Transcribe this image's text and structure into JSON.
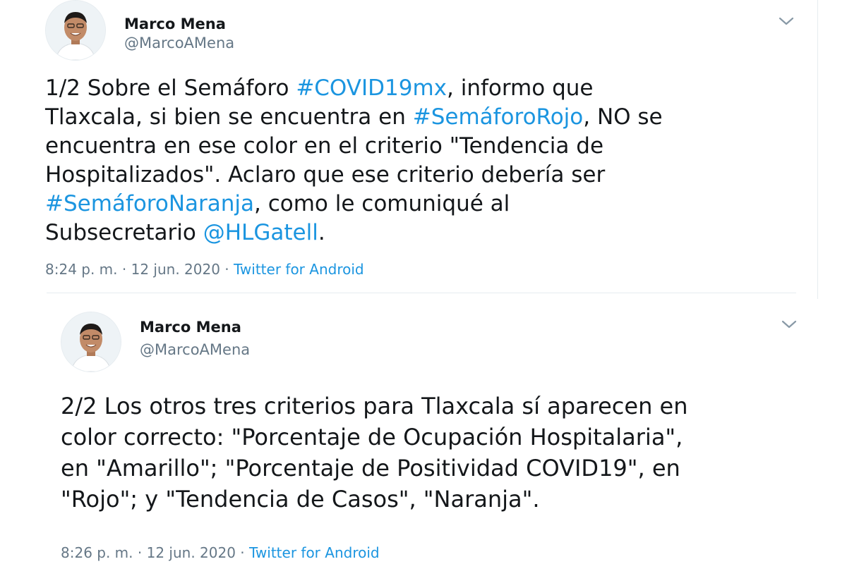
{
  "tweets": [
    {
      "author": {
        "name": "Marco Mena",
        "handle": "@MarcoAMena"
      },
      "menu_icon": "chevron-down-icon",
      "text": {
        "l1_a": "1/2 Sobre el Semáforo ",
        "l1_link": "#COVID19mx",
        "l1_b": ", informo que",
        "l2_a": "Tlaxcala, si bien se encuentra en ",
        "l2_link": "#SemáforoRojo",
        "l2_b": ", NO se",
        "l3": "encuentra en ese color en el criterio \"Tendencia de",
        "l4": "Hospitalizados\". Aclaro que ese criterio debería ser",
        "l5_link": "#SemáforoNaranja",
        "l5_b": ", como le comuniqué al",
        "l6_a": "Subsecretario ",
        "l6_link": "@HLGatell",
        "l6_b": "."
      },
      "meta": {
        "time": "8:24 p. m.",
        "sep1": " · ",
        "date": "12 jun. 2020",
        "sep2": " · ",
        "source": "Twitter for Android"
      }
    },
    {
      "author": {
        "name": "Marco Mena",
        "handle": "@MarcoAMena"
      },
      "menu_icon": "chevron-down-icon",
      "text": {
        "l1": "2/2 Los otros tres criterios para Tlaxcala sí aparecen en",
        "l2": "color correcto: \"Porcentaje de Ocupación Hospitalaria\",",
        "l3": "en \"Amarillo\"; \"Porcentaje de Positividad COVID19\", en",
        "l4": "\"Rojo\"; y \"Tendencia de Casos\", \"Naranja\"."
      },
      "meta": {
        "time": "8:26 p. m.",
        "sep1": " · ",
        "date": "12 jun. 2020",
        "sep2": " · ",
        "source": "Twitter for Android"
      }
    }
  ],
  "colors": {
    "link": "#1b95e0",
    "text": "#14171a",
    "muted": "#657786"
  }
}
